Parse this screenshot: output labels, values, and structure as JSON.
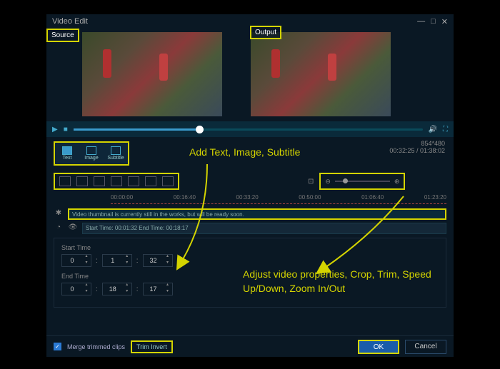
{
  "title": "Video Edit",
  "labels": {
    "source": "Source",
    "output": "Output"
  },
  "tabs": [
    {
      "label": "Text"
    },
    {
      "label": "Image"
    },
    {
      "label": "Subtitle"
    }
  ],
  "resolution": "854*480",
  "position": "00:32:25 / 01:38:02",
  "ruler": [
    "00:00:00",
    "00:16:40",
    "00:33:20",
    "00:50:00",
    "01:06:40",
    "01:23:20"
  ],
  "thumbnail_msg": "Video thumbnail is currently still in the works, but will be ready soon.",
  "timecode": "Start Time: 00:01:32   End Time: 00:18:17",
  "start": {
    "label": "Start Time",
    "h": "0",
    "m": "1",
    "s": "32"
  },
  "end": {
    "label": "End Time",
    "h": "0",
    "m": "18",
    "s": "17"
  },
  "merge": "Merge trimmed clips",
  "triminvert": "Trim Invert",
  "ok": "OK",
  "cancel": "Cancel",
  "annotations": {
    "a1": "Add Text, Image, Subtitle",
    "a2": "Adjust video properties, Crop, Trim, Speed Up/Down, Zoom In/Out"
  }
}
